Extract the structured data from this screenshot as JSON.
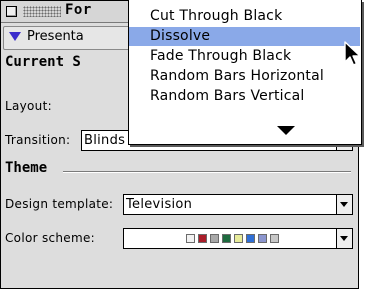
{
  "window": {
    "title": "Formatting Palette",
    "title_visible": "For"
  },
  "section": {
    "label": "Presentation",
    "label_visible": "Presenta"
  },
  "current_slide": {
    "heading": "Current Slide",
    "heading_visible": "Current S",
    "layout_label": "Layout:",
    "transition_label": "Transition:",
    "transition_value": "Blinds Horizontal"
  },
  "theme": {
    "heading": "Theme",
    "design_template_label": "Design template:",
    "design_template_value": "Television",
    "color_scheme_label": "Color scheme:",
    "color_scheme_swatches": [
      "#f2f2f2",
      "#aa1d2a",
      "#a9a9a9",
      "#1e6b3f",
      "#e8ec9a",
      "#2f6fd6",
      "#8c96cf",
      "#c8c8c8"
    ]
  },
  "transition_menu": {
    "items": [
      {
        "label": "Cut Through Black",
        "highlighted": false
      },
      {
        "label": "Dissolve",
        "highlighted": true
      },
      {
        "label": "Fade Through Black",
        "highlighted": false
      },
      {
        "label": "Random Bars Horizontal",
        "highlighted": false
      },
      {
        "label": "Random Bars Vertical",
        "highlighted": false
      }
    ],
    "more_indicator": "scroll-down-arrow-icon"
  },
  "colors": {
    "palette_bg": "#dddddd",
    "menu_highlight": "#8aa9e8",
    "disclosure_triangle": "#3a2ccc"
  }
}
